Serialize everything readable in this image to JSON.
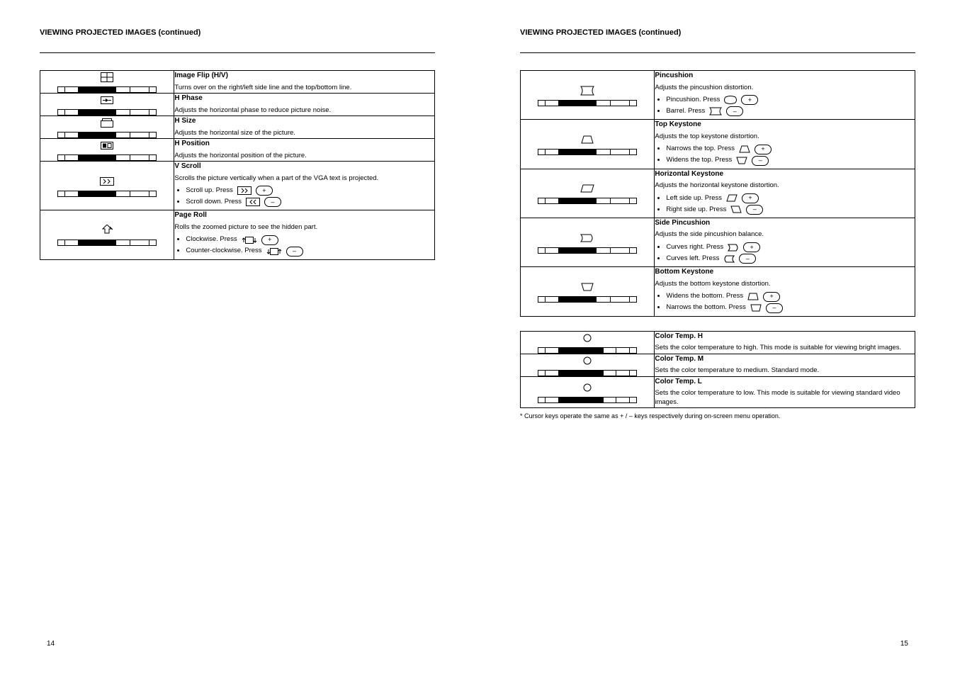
{
  "left": {
    "section_title": "VIEWING PROJECTED IMAGES (continued)",
    "rows": [
      {
        "title": "Image Flip (H/V)",
        "desc": "Turns over on the right/left side line and the top/bottom line.",
        "bullets": []
      },
      {
        "title": "H Phase",
        "desc": "Adjusts the horizontal phase to reduce picture noise.",
        "bullets": []
      },
      {
        "title": "H Size",
        "desc": "Adjusts the horizontal size of the picture.",
        "bullets": []
      },
      {
        "title": "H Position",
        "desc": "Adjusts the horizontal position of the picture.",
        "bullets": []
      },
      {
        "title": "V Scroll",
        "desc": "Scrolls the picture vertically when a part of the VGA text is projected.",
        "bullets": [
          {
            "pre": "Scroll up. Press",
            "btn": "+"
          },
          {
            "pre": "Scroll down. Press",
            "btn": "–"
          }
        ],
        "bullet_icons": [
          "scroll-up",
          "scroll-down"
        ]
      },
      {
        "title": "Page Roll",
        "desc": "Rolls the zoomed picture to see the hidden part.",
        "bullets": [
          {
            "pre": "Clockwise. Press",
            "btn": "+"
          },
          {
            "pre": "Counter-clockwise. Press",
            "btn": "–"
          }
        ],
        "bullet_icons": [
          "rotate-cw",
          "rotate-ccw"
        ]
      }
    ],
    "page_number": "14"
  },
  "right": {
    "section_title": "VIEWING PROJECTED IMAGES (continued)",
    "rows_a": [
      {
        "title": "Pincushion",
        "desc": "Adjusts the pincushion distortion.",
        "bullets": [
          {
            "pre": "Pincushion. Press",
            "btn": "+"
          },
          {
            "pre": "Barrel. Press",
            "btn": "–"
          }
        ],
        "bullet_icons": [
          "pincushion-out",
          "pincushion-in"
        ]
      },
      {
        "title": "Top Keystone",
        "desc": "Adjusts the top keystone distortion.",
        "bullets": [
          {
            "pre": "Narrows the top. Press",
            "btn": "+"
          },
          {
            "pre": "Widens the top. Press",
            "btn": "–"
          }
        ],
        "bullet_icons": [
          "trap-top-narrow",
          "trap-top-wide"
        ]
      },
      {
        "title": "Horizontal Keystone",
        "desc": "Adjusts the horizontal keystone distortion.",
        "bullets": [
          {
            "pre": "Left side up. Press",
            "btn": "+"
          },
          {
            "pre": "Right side up. Press",
            "btn": "–"
          }
        ],
        "bullet_icons": [
          "skew-left",
          "skew-right"
        ]
      },
      {
        "title": "Side Pincushion",
        "desc": "Adjusts the side pincushion balance.",
        "bullets": [
          {
            "pre": "Curves right. Press",
            "btn": "+"
          },
          {
            "pre": "Curves left. Press",
            "btn": "–"
          }
        ],
        "bullet_icons": [
          "pin-side-right",
          "pin-side-left"
        ]
      },
      {
        "title": "Bottom Keystone",
        "desc": "Adjusts the bottom keystone distortion.",
        "bullets": [
          {
            "pre": "Widens the bottom. Press",
            "btn": "+"
          },
          {
            "pre": "Narrows the bottom. Press",
            "btn": "–"
          }
        ],
        "bullet_icons": [
          "trap-btm-wide",
          "trap-btm-narrow"
        ]
      }
    ],
    "rows_b": [
      {
        "title": "Color Temp. H",
        "desc": "Sets the color temperature to high. This mode is suitable for viewing bright images.",
        "bullets": []
      },
      {
        "title": "Color Temp. M",
        "desc": "Sets the color temperature to medium. Standard mode.",
        "bullets": []
      },
      {
        "title": "Color Temp. L",
        "desc": "Sets the color temperature to low. This mode is suitable for viewing standard video images.",
        "bullets": []
      }
    ],
    "note": "* Cursor keys operate the same as + / – keys respectively during on-screen menu operation.",
    "page_number": "15"
  }
}
